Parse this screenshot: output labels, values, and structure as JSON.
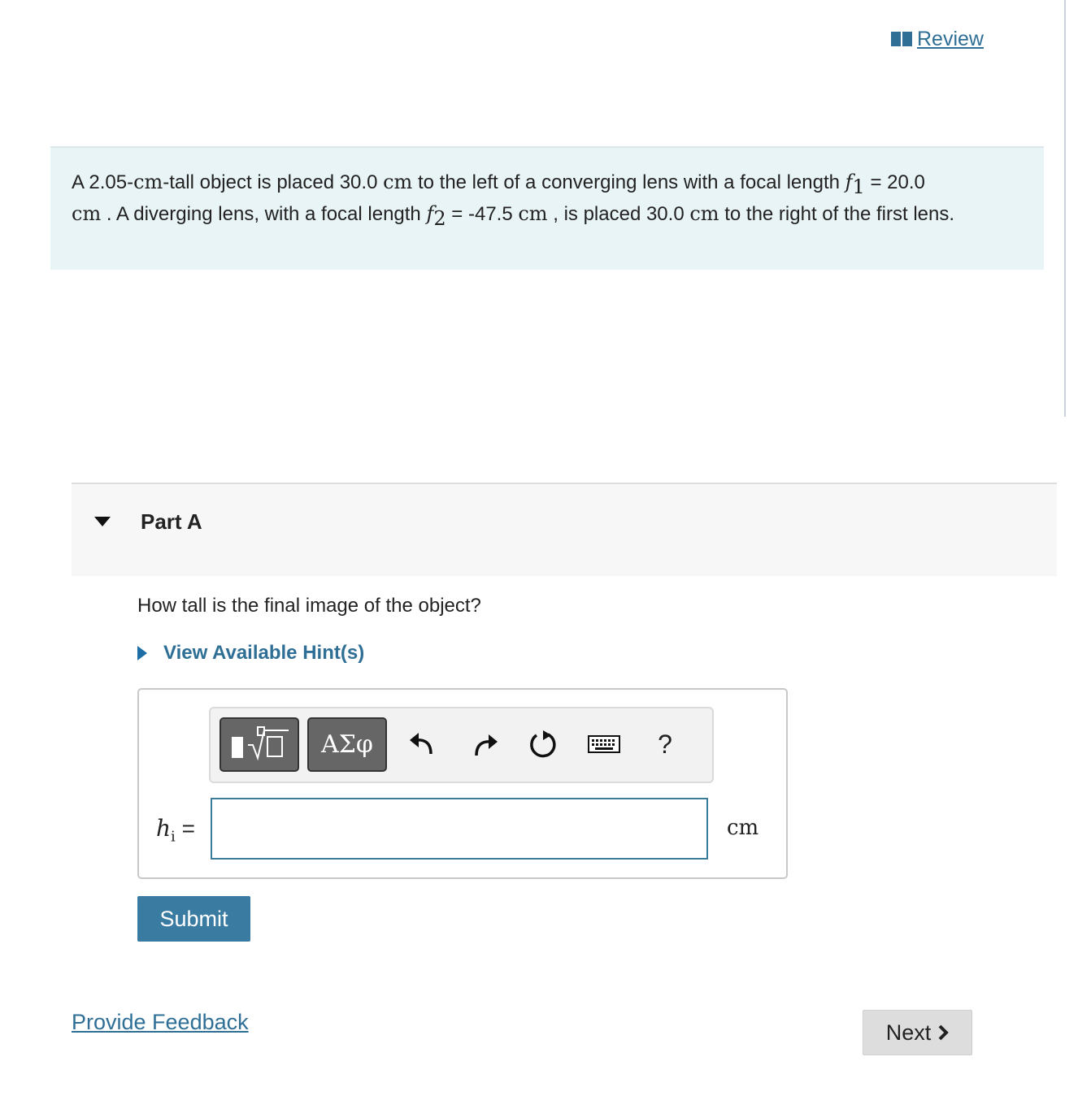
{
  "header": {
    "review_label": " Review"
  },
  "problem": {
    "p1": "A 2.05-",
    "u_cm1": "cm",
    "p2": "-tall object is placed 30.0 ",
    "u_cm2": "cm",
    "p3": " to the left of a converging lens with a focal length ",
    "f1_var": "f",
    "f1_sub": "1",
    "p4": " = 20.0",
    "u_cm3": "cm",
    "p5": " . A diverging lens, with a focal length ",
    "f2_var": "f",
    "f2_sub": "2",
    "p6": " = -47.5 ",
    "u_cm4": "cm",
    "p7": " , is placed 30.0 ",
    "u_cm5": "cm",
    "p8": " to the right of the first lens."
  },
  "part": {
    "title": "Part A"
  },
  "question": "How tall is the final image of the object?",
  "hints": {
    "label": "View Available Hint(s)"
  },
  "toolbar": {
    "symbols_label": "ΑΣφ",
    "help_label": "?",
    "icons": [
      "templates-icon",
      "undo-icon",
      "redo-icon",
      "reset-icon",
      "keyboard-icon",
      "help-icon"
    ]
  },
  "answer": {
    "var": "h",
    "var_sub": "i",
    "equals": "=",
    "value": "",
    "unit": "cm"
  },
  "buttons": {
    "submit": "Submit",
    "next": "Next",
    "feedback": "Provide Feedback"
  },
  "colors": {
    "accent": "#2f6f96",
    "submit_bg": "#3a7ba1",
    "intro_bg": "#e9f4f6",
    "part_bg": "#f7f7f7"
  }
}
